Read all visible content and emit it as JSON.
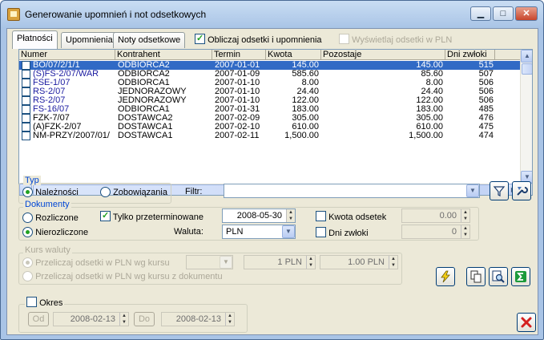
{
  "window": {
    "title": "Generowanie upomnień i not odsetkowych",
    "minimize": "▁",
    "maximize": "□",
    "close": "✕"
  },
  "tabs": [
    {
      "label": "Płatności"
    },
    {
      "label": "Upomnienia"
    },
    {
      "label": "Noty odsetkowe"
    }
  ],
  "options": {
    "calc_interest_label": "Obliczaj odsetki i upomnienia",
    "show_pln_label": "Wyświetlaj odsetki w PLN"
  },
  "grid": {
    "columns": [
      "Numer",
      "Kontrahent",
      "Termin",
      "Kwota",
      "Pozostaje",
      "Dni zwłoki"
    ],
    "rows": [
      {
        "numer": "BO/07/2/1/1",
        "kontrahent": "ODBIORCA2",
        "termin": "2007-01-01",
        "kwota": "145.00",
        "pozostaje": "145.00",
        "dni": "515",
        "blue": true
      },
      {
        "numer": "(S)FS-2/07/WAR",
        "kontrahent": "ODBIORCA2",
        "termin": "2007-01-09",
        "kwota": "585.60",
        "pozostaje": "85.60",
        "dni": "507",
        "blue": true
      },
      {
        "numer": "FSE-1/07",
        "kontrahent": "ODBIORCA1",
        "termin": "2007-01-10",
        "kwota": "8.00",
        "pozostaje": "8.00",
        "dni": "506",
        "blue": true
      },
      {
        "numer": "RS-2/07",
        "kontrahent": "JEDNORAZOWY",
        "termin": "2007-01-10",
        "kwota": "24.40",
        "pozostaje": "24.40",
        "dni": "506",
        "blue": true
      },
      {
        "numer": "RS-2/07",
        "kontrahent": "JEDNORAZOWY",
        "termin": "2007-01-10",
        "kwota": "122.00",
        "pozostaje": "122.00",
        "dni": "506",
        "blue": true
      },
      {
        "numer": "FS-16/07",
        "kontrahent": "ODBIORCA1",
        "termin": "2007-01-31",
        "kwota": "183.00",
        "pozostaje": "183.00",
        "dni": "485",
        "blue": true
      },
      {
        "numer": "FZK-7/07",
        "kontrahent": "DOSTAWCA2",
        "termin": "2007-02-09",
        "kwota": "305.00",
        "pozostaje": "305.00",
        "dni": "476",
        "blue": false
      },
      {
        "numer": "(A)FZK-2/07",
        "kontrahent": "DOSTAWCA1",
        "termin": "2007-02-10",
        "kwota": "610.00",
        "pozostaje": "610.00",
        "dni": "475",
        "blue": false
      },
      {
        "numer": "NM-PRZY/2007/01/",
        "kontrahent": "DOSTAWCA1",
        "termin": "2007-02-11",
        "kwota": "1,500.00",
        "pozostaje": "1,500.00",
        "dni": "474",
        "blue": false
      }
    ]
  },
  "typ": {
    "title": "Typ",
    "naleznosci": "Należności",
    "zobowiazania": "Zobowiązania",
    "filter_label": "Filtr:",
    "filter_value": ""
  },
  "dokumenty": {
    "title": "Dokumenty",
    "rozliczone": "Rozliczone",
    "nierozliczone": "Nierozliczone",
    "tylko_przeterminowane": "Tylko przeterminowane",
    "date": "2008-05-30",
    "waluta_label": "Waluta:",
    "waluta_value": "PLN",
    "kwota_odsetek_label": "Kwota odsetek",
    "kwota_odsetek_value": "0.00",
    "dni_zwloki_label": "Dni zwłoki",
    "dni_zwloki_value": "0"
  },
  "kurs": {
    "title": "Kurs waluty",
    "option1": "Przeliczaj odsetki w PLN wg kursu",
    "option2": "Przeliczaj odsetki w PLN wg kursu z dokumentu",
    "select_value": "",
    "rate1": "1 PLN",
    "rate2": "1.00 PLN"
  },
  "okres": {
    "label": "Okres",
    "od_label": "Od",
    "od_value": "2008-02-13",
    "do_label": "Do",
    "do_value": "2008-02-13"
  },
  "colors": {
    "selection": "#316ac5",
    "group_title": "#0046d5",
    "blue_doc": "#1a1aa0"
  }
}
